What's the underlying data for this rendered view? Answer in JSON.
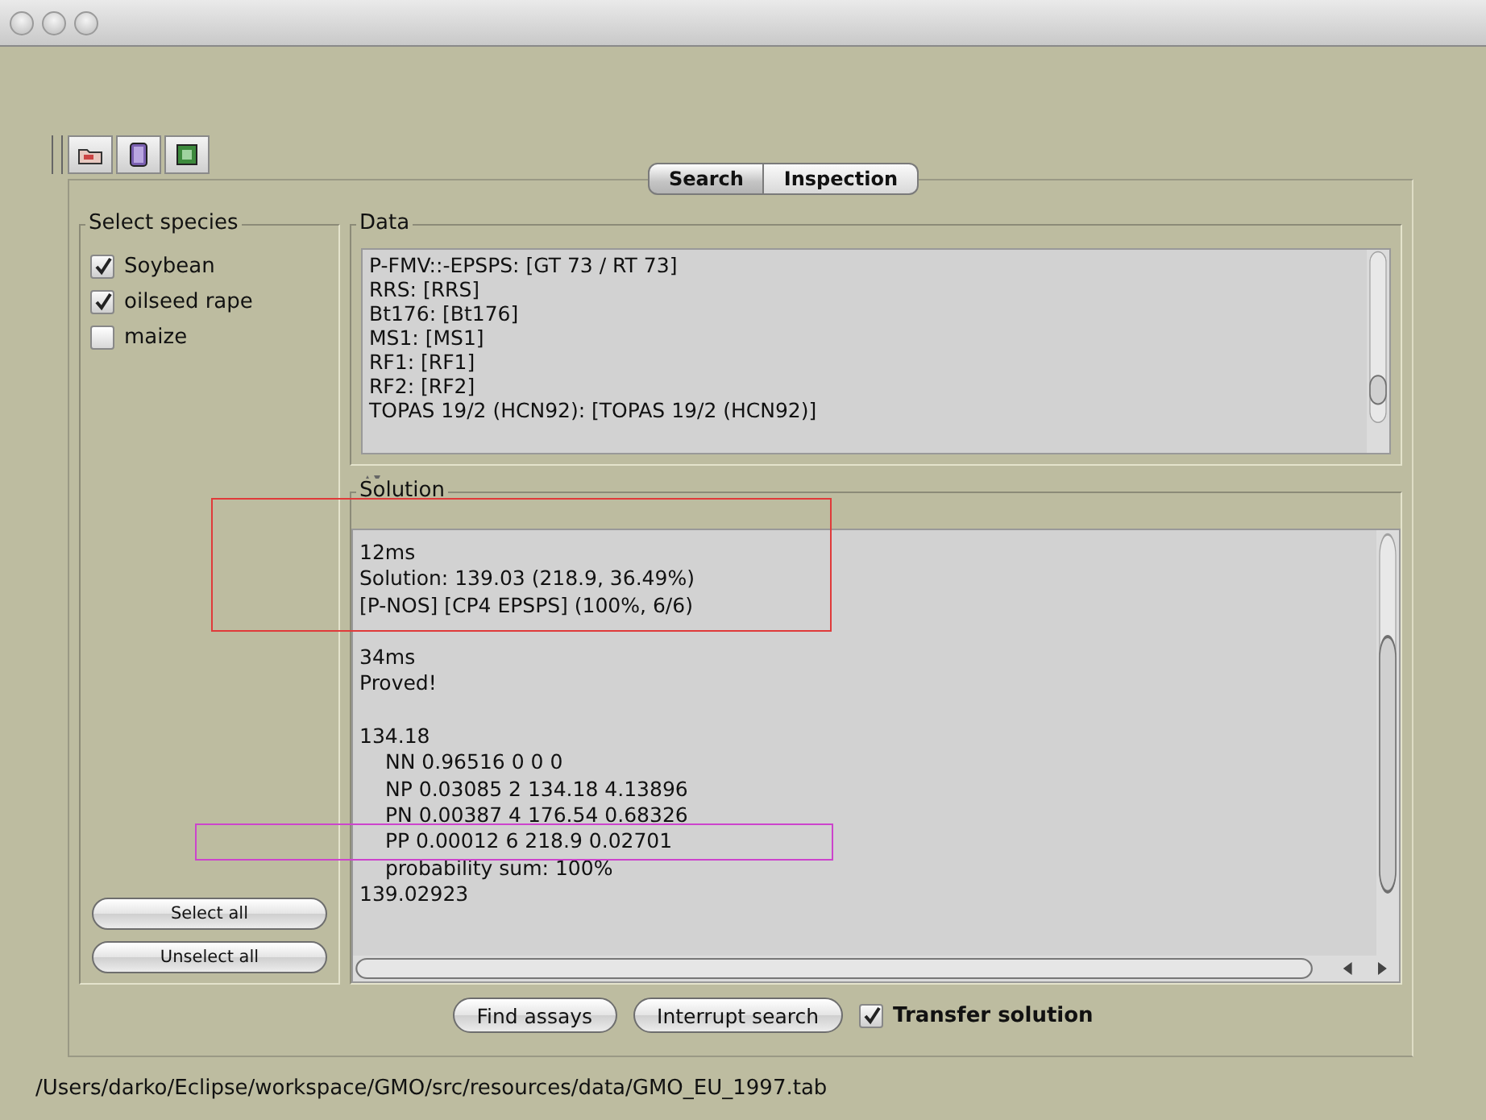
{
  "toolbar": {
    "buttons": [
      {
        "kind": "folder"
      },
      {
        "kind": "book"
      },
      {
        "kind": "sheet"
      }
    ]
  },
  "tabs": [
    {
      "label": "Search",
      "selected": true
    },
    {
      "label": "Inspection",
      "selected": false
    }
  ],
  "species": {
    "title": "Select species",
    "items": [
      {
        "label": "Soybean",
        "checked": true
      },
      {
        "label": "oilseed rape",
        "checked": true
      },
      {
        "label": "maize",
        "checked": false
      }
    ],
    "buttons": [
      "Select all",
      "Unselect all"
    ]
  },
  "data": {
    "title": "Data",
    "lines": [
      "P-FMV::-EPSPS: [GT 73 / RT 73]",
      "RRS: [RRS]",
      "Bt176: [Bt176]",
      "MS1: [MS1]",
      "RF1: [RF1]",
      "RF2: [RF2]",
      "TOPAS 19/2 (HCN92): [TOPAS 19/2 (HCN92)]"
    ]
  },
  "solution": {
    "title": "Solution",
    "blocks": [
      [
        {
          "text": "12ms"
        },
        {
          "text": "Solution: 139.03 (218.9, 36.49%)"
        },
        {
          "text": "[P-NOS] [CP4 EPSPS] (100%, 6/6)"
        }
      ],
      [
        {
          "text": "34ms"
        },
        {
          "text": "Proved!"
        }
      ],
      [
        {
          "text": "134.18",
          "children": [
            {
              "text": "NN 0.96516 0 0 0"
            },
            {
              "text": "NP 0.03085 2 134.18 4.13896"
            },
            {
              "text": "PN 0.00387 4 176.54 0.68326"
            },
            {
              "text": "PP 0.00012 6 218.9 0.02701"
            },
            {
              "text": "probability sum: 100%"
            }
          ]
        },
        {
          "text": "139.02923"
        }
      ]
    ]
  },
  "actions": {
    "buttons": [
      "Find assays",
      "Interrupt search"
    ],
    "transfer": {
      "label": "Transfer solution",
      "checked": true
    }
  },
  "status_bar": "/Users/darko/Eclipse/workspace/GMO/src/resources/data/GMO_EU_1997.tab",
  "annotations": [
    {
      "color": "#e03a3a"
    },
    {
      "color": "#cc44cc"
    }
  ]
}
